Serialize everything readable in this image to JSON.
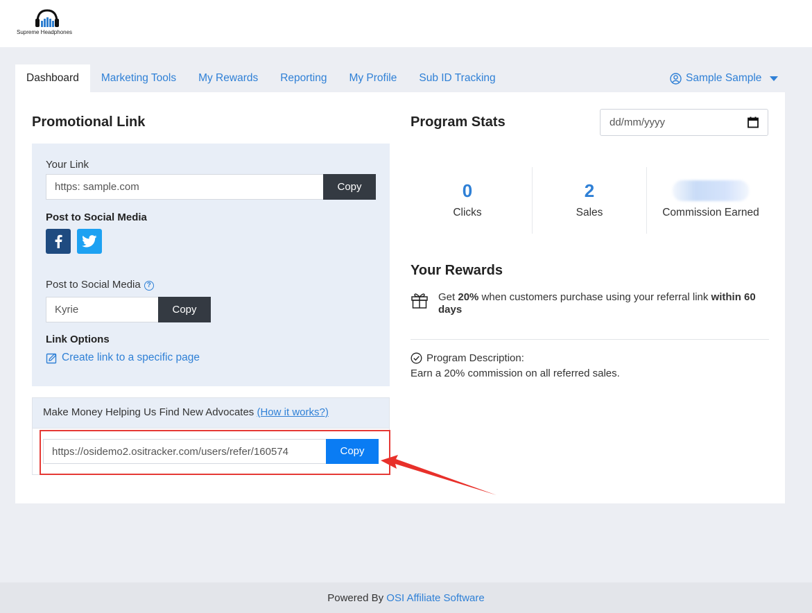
{
  "brand": {
    "name": "Supreme Headphones"
  },
  "nav": {
    "tabs": [
      {
        "label": "Dashboard"
      },
      {
        "label": "Marketing Tools"
      },
      {
        "label": "My Rewards"
      },
      {
        "label": "Reporting"
      },
      {
        "label": "My Profile"
      },
      {
        "label": "Sub ID Tracking"
      }
    ],
    "active_tab": "Dashboard",
    "user_name": "Sample Sample"
  },
  "promo": {
    "title": "Promotional Link",
    "your_link_label": "Your Link",
    "your_link_value": "https: sample.com",
    "copy_label": "Copy",
    "social_label": "Post to Social Media",
    "social_label_2": "Post to Social Media",
    "social_code_value": "Kyrie",
    "copy_label_2": "Copy",
    "link_options_label": "Link Options",
    "create_link_label": "Create link to a specific page"
  },
  "advocates": {
    "text": "Make Money Helping Us Find New Advocates",
    "how_link": "(How it works?)",
    "refer_url": "https://osidemo2.ositracker.com/users/refer/160574",
    "copy_label": "Copy"
  },
  "stats": {
    "title": "Program Stats",
    "date_placeholder": "dd/mm/yyyy",
    "clicks_value": "0",
    "clicks_label": "Clicks",
    "sales_value": "2",
    "sales_label": "Sales",
    "commission_label": "Commission Earned"
  },
  "rewards": {
    "title": "Your Rewards",
    "text_pre": "Get ",
    "text_pct": "20%",
    "text_mid": " when customers purchase using your referral link ",
    "text_bold": "within 60 days",
    "desc_label": "Program Description:",
    "desc_text": "Earn a 20% commission on all referred sales."
  },
  "footer": {
    "powered": "Powered By ",
    "link": "OSI Affiliate Software"
  },
  "colors": {
    "accent": "#2f80d6",
    "dark_button": "#343a42",
    "blue_button": "#0a7cf3",
    "highlight_red": "#e53935",
    "facebook": "#1f4b80",
    "twitter": "#1da1f2"
  }
}
